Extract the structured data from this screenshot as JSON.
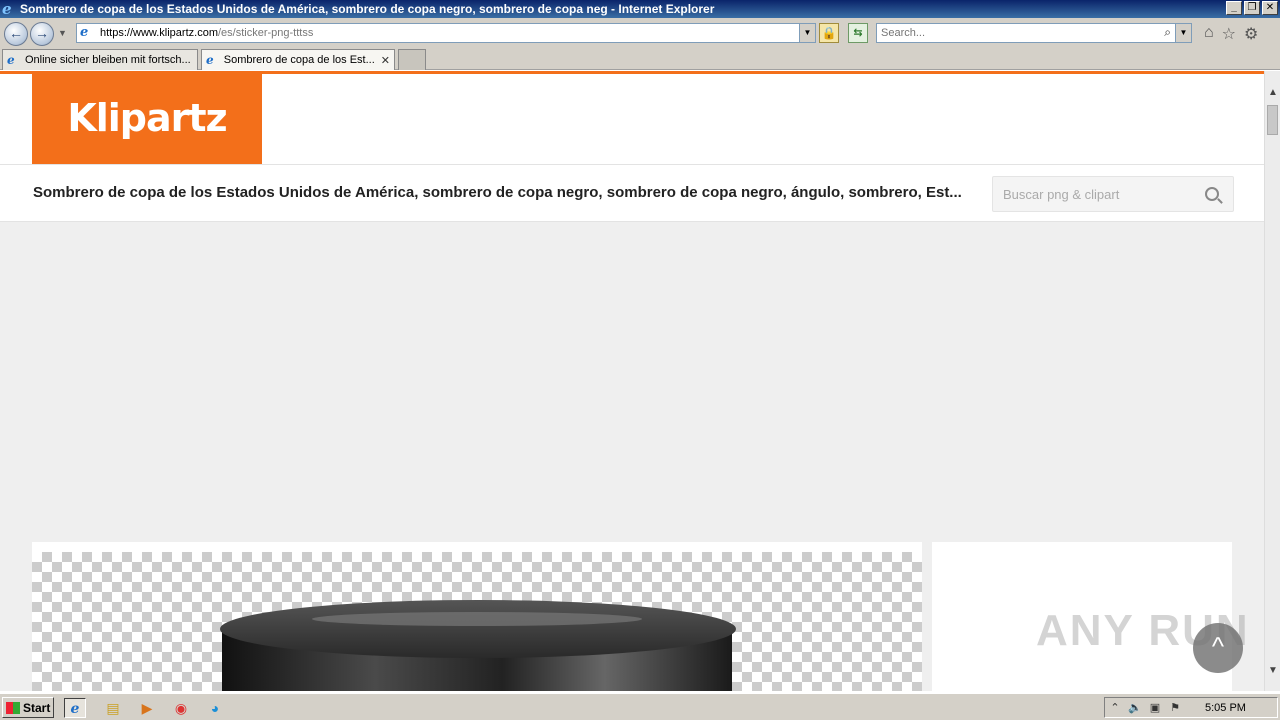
{
  "window": {
    "title": "Sombrero de copa de los Estados Unidos de América, sombrero de copa negro, sombrero de copa neg - Internet Explorer",
    "minimize": "_",
    "restore": "❐",
    "close": "✕"
  },
  "toolbar": {
    "url_host": "https://www.klipartz.com",
    "url_path": "/es/sticker-png-tttss",
    "search_placeholder": "Search..."
  },
  "tabs": [
    {
      "label": "Online sicher bleiben mit fortsch..."
    },
    {
      "label": "Sombrero de copa de los Est...",
      "close": "✕"
    }
  ],
  "site": {
    "logo": "Klipartz",
    "page_title": "Sombrero de copa de los Estados Unidos de América, sombrero de copa negro, sombrero de copa negro, ángulo, sombrero, Est...",
    "search_placeholder": "Buscar png & clipart"
  },
  "overlay": {
    "watermark": "ANY RUN",
    "scroll_top": "^"
  },
  "taskbar": {
    "start_label": "Start",
    "clock": "5:05 PM"
  },
  "colors": {
    "brand_orange": "#f36f1a",
    "titlebar_blue": "#0a246a"
  }
}
